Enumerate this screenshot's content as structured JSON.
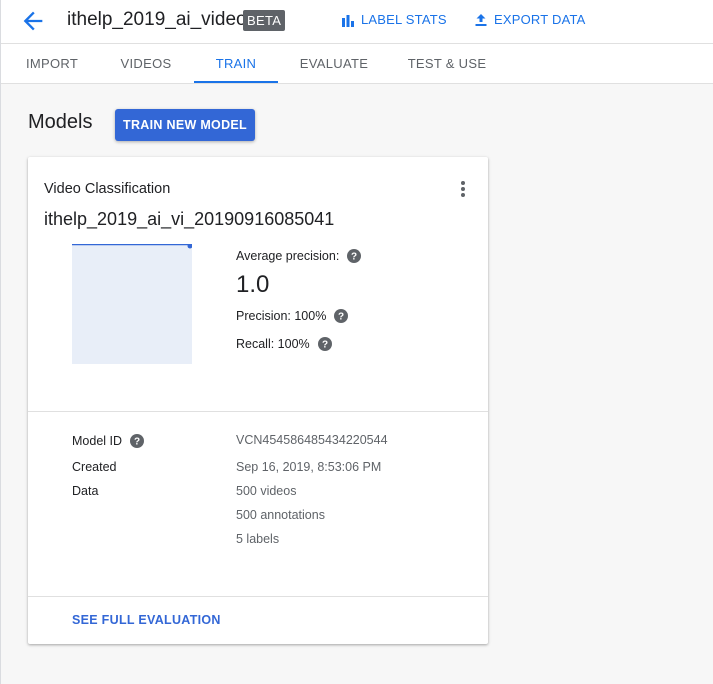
{
  "header": {
    "title": "ithelp_2019_ai_video",
    "badge": "BETA",
    "label_stats": "LABEL STATS",
    "export_data": "EXPORT DATA"
  },
  "tabs": [
    {
      "label": "IMPORT"
    },
    {
      "label": "VIDEOS"
    },
    {
      "label": "TRAIN",
      "active": true
    },
    {
      "label": "EVALUATE"
    },
    {
      "label": "TEST & USE"
    }
  ],
  "models": {
    "heading": "Models",
    "train_button": "TRAIN NEW MODEL"
  },
  "card": {
    "type": "Video Classification",
    "model_name": "ithelp_2019_ai_vi_20190916085041",
    "average_precision_label": "Average precision:",
    "average_precision_value": "1.0",
    "precision": "Precision: 100%",
    "recall": "Recall: 100%",
    "details": {
      "model_id_label": "Model ID",
      "model_id_value": "VCN454586485434220544",
      "created_label": "Created",
      "created_value": "Sep 16, 2019, 8:53:06 PM",
      "data_label": "Data",
      "data_values": [
        "500 videos",
        "500 annotations",
        "5 labels"
      ]
    },
    "see_full_evaluation": "SEE FULL EVALUATION"
  },
  "colors": {
    "accent": "#1a73e8",
    "button": "#3367d6",
    "chart_fill": "#e8eef8"
  },
  "icons": {
    "back": "arrow-back-icon",
    "label_stats": "bar-chart-icon",
    "export": "upload-icon",
    "menu": "more-vert-icon",
    "help": "help-icon"
  }
}
